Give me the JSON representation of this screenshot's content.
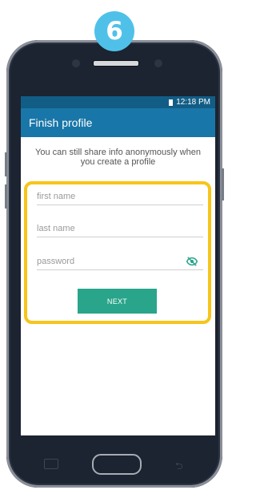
{
  "step_badge": "6",
  "status_bar": {
    "time": "12:18 PM"
  },
  "app_bar": {
    "title": "Finish profile"
  },
  "info_text": "You can still share info anonymously when you create a profile",
  "form": {
    "first_name_placeholder": "first name",
    "last_name_placeholder": "last name",
    "password_placeholder": "password",
    "next_label": "NEXT"
  },
  "colors": {
    "status_bar": "#125d86",
    "app_bar": "#1976a8",
    "highlight_border": "#f7c41a",
    "next_button": "#28a58a",
    "badge": "#4fc1e9"
  },
  "icons": {
    "password_toggle": "eye-slash-icon"
  }
}
